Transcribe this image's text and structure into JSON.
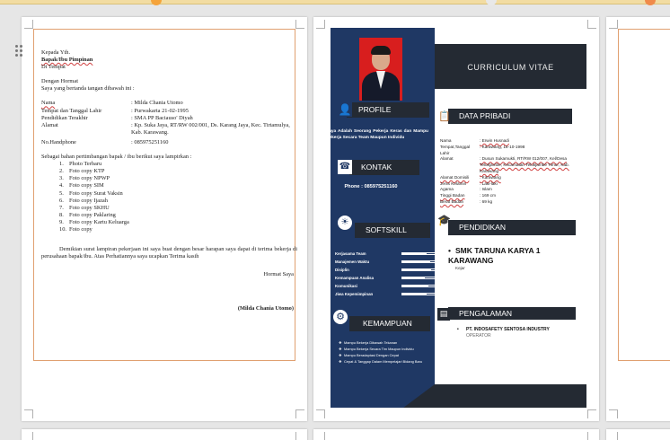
{
  "letter": {
    "lines_top": [
      "Kepada Yth.",
      "Bapak/Ibu Pimpinan",
      "Di Tempat"
    ],
    "salutation": "Dengan Hormat",
    "intro": "Saya yang bertanda tangan dibawah ini :",
    "fields": [
      {
        "key": "Nama",
        "value": ": Milda Chania Utomo"
      },
      {
        "key": "Tempat dan Tanggal Lahir",
        "value": ": Purwakarta 21-02-1995"
      },
      {
        "key": "Pendidikan Terakhir",
        "value": ": SMA  PP Baciauso' Diyah"
      },
      {
        "key": "Alamat",
        "value": ": Kp. Suka Jaya, RT/RW 002/001, Ds. Karang Jaya, Kec. Tirtamulya, Kab. Karawang."
      },
      {
        "key": "No.Handphone",
        "value": ": 085975251160"
      }
    ],
    "attach_intro": "Sebagai bahan pertimbangan bapak / ibu berikut saya lampirkan :",
    "attachments": [
      "Photo Terbaru",
      "Foto copy KTP",
      "Foto copy NPWP",
      "Foto copy SIM",
      "Foto copy Surat Vaksin",
      "Foto copy Ijazah",
      "Foto copy SKHU",
      "Foto copy Paklaring",
      "Foto copy Kartu Keluarga",
      "Foto copy"
    ],
    "closing": "Demikian surat lampiran pekerjaan ini saya buat dengan besar harapan saya dapat di terima bekerja di perusahaan bapak/ibu. Atas Perhatiannya saya ucapkan Terima kasih",
    "regards": "Hormat Saya",
    "signature": "(Milda Chania Utomo)"
  },
  "cv": {
    "title": "CURRICULUM VITAE",
    "sections": {
      "profile": "PROFILE",
      "kontak": "KONTAK",
      "softskill": "SOFTSKILL",
      "kemampuan": "KEMAMPUAN",
      "data_pribadi": "DATA PRIBADI",
      "pendidikan": "PENDIDIKAN",
      "pengalaman": "PENGALAMAN"
    },
    "profile_text": "Saya Adalah Seorang Pekerja Keras dan Mampu Bekerja Secara Team Maupun Individu",
    "phone": "Phone : 085975251160",
    "skills": [
      {
        "name": "Kerjasama Team",
        "level": 0.75
      },
      {
        "name": "Manajemen Waktu",
        "level": 0.85
      },
      {
        "name": "Disiplin",
        "level": 0.9
      },
      {
        "name": "Kemampuan Analisa",
        "level": 0.7
      },
      {
        "name": "Komunikasi",
        "level": 0.8
      },
      {
        "name": "Jiwa Kepemimpinan",
        "level": 0.75
      }
    ],
    "kemampuan": [
      "Mampu Bekerja Dibawah Tekanan",
      "Mampu Bekerja Secara Tim Maupun Individu",
      "Mampu Beradaptasi Dengan Cepat",
      "Cepat & Tanggap Dalam Mempelajari Bidang Baru"
    ],
    "data_pribadi": [
      {
        "key": "Nama",
        "value": ": Erwin Husnadi"
      },
      {
        "key": "Tempat,Tanggal Lahir",
        "value": ": Karawang, 15-10-1998"
      },
      {
        "key": "Alamat",
        "value": ": Dusun Sukamukti, RT/RW 012/007, Kel/Desa Telukjambe, Kecamatan Telukjambe Timur, Kab. Karawang"
      },
      {
        "key": "Alamat Domisili",
        "value": ": Karawang"
      },
      {
        "key": "Jenis Kelamin",
        "value": ": Laki-laki"
      },
      {
        "key": "Agama",
        "value": ": Islam"
      },
      {
        "key": "Tinggi Badan",
        "value": ": 169 cm"
      },
      {
        "key": "Berat Badan",
        "value": ": 69 kg"
      }
    ],
    "school": "SMK TARUNA KARYA 1 KARAWANG",
    "school_status": "Kejar",
    "company": "PT. INDOSAFETY SENTOSA INDUSTRY",
    "position": "OPERATOR"
  }
}
